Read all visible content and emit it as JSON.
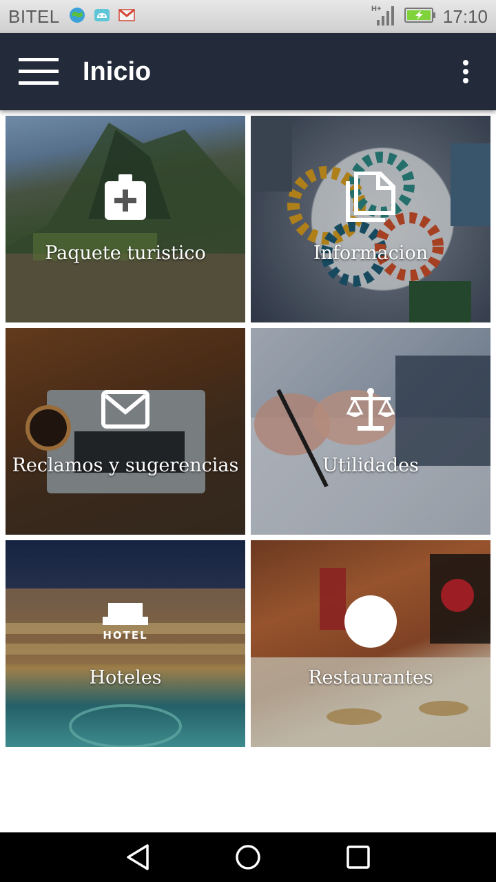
{
  "status_bar": {
    "carrier": "BITEL",
    "network": "H+",
    "time": "17:10",
    "icons": [
      "globe-app-icon",
      "android-icon",
      "gmail-icon",
      "signal-icon",
      "battery-charging-icon"
    ]
  },
  "app_bar": {
    "title": "Inicio",
    "menu_icon": "hamburger-menu-icon",
    "overflow_icon": "more-vert-icon",
    "background": "#232b3a"
  },
  "tiles": [
    {
      "label": "Paquete turistico",
      "icon": "medical-bag-icon"
    },
    {
      "label": "Informacion",
      "icon": "copy-documents-icon"
    },
    {
      "label": "Reclamos y sugerencias",
      "icon": "mail-icon"
    },
    {
      "label": "Utilidades",
      "icon": "balance-scale-icon"
    },
    {
      "label": "Hoteles",
      "icon": "hotel-icon",
      "icon_text": "HOTEL"
    },
    {
      "label": "Restaurantes",
      "icon": "white-circle-icon"
    }
  ],
  "nav_bar": {
    "icons": [
      "back-icon",
      "home-icon",
      "recents-icon"
    ]
  }
}
